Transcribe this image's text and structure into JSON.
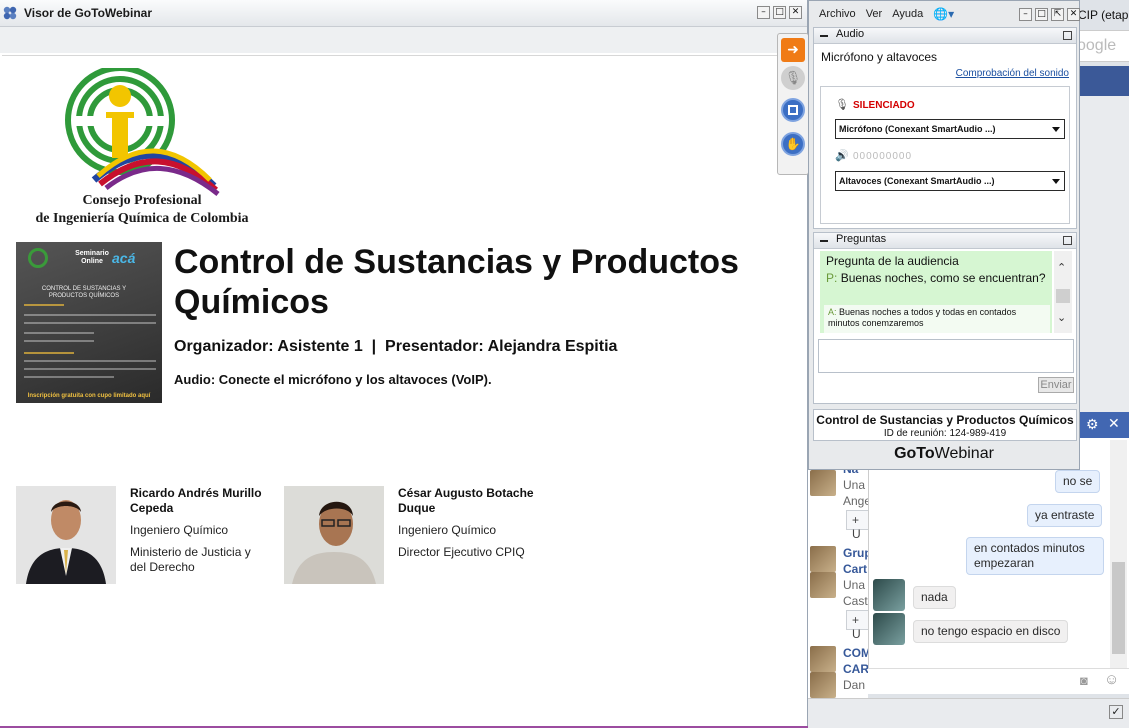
{
  "viewer": {
    "title": "Visor de GoToWebinar",
    "logo_line1": "Consejo Profesional",
    "logo_line2": "de Ingeniería Química de Colombia",
    "webinar_title": "Control de Sustancias y Productos Químicos",
    "organizer_line": "Organizador: Asistente 1  |  Presentador: Alejandra Espitia",
    "audio_line": "Audio: Conecte el micrófono y los altavoces (VoIP).",
    "poster": {
      "seminar": "Seminario Online",
      "aca": "acá",
      "heading": "CONTROL DE SUSTANCIAS Y PRODUCTOS QUÍMICOS",
      "footer": "Inscripción gratuita con cupo limitado aquí"
    },
    "speakers": [
      {
        "name": "Ricardo Andrés Murillo Cepeda",
        "role": "Ingeniero Químico",
        "org": "Ministerio de Justicia y del Derecho"
      },
      {
        "name": "César Augusto Botache Duque",
        "role": "Ingeniero Químico",
        "org": "Director Ejecutivo CPIQ"
      }
    ]
  },
  "panel": {
    "menu": [
      "Archivo",
      "Ver",
      "Ayuda"
    ],
    "audio": {
      "header": "Audio",
      "mode": "Micrófono y altavoces",
      "sound_check": "Comprobación del sonido",
      "status": "SILENCIADO",
      "mic_device": "Micrófono (Conexant SmartAudio ...)",
      "speaker_level": "000000000",
      "speaker_device": "Altavoces (Conexant SmartAudio ...)"
    },
    "questions": {
      "header": "Preguntas",
      "audience_label": "Pregunta de la audiencia",
      "q_prefix": "P:",
      "q_text": "Buenas noches, como se encuentran?",
      "a_prefix": "A:",
      "a_text": "Buenas noches a todos y todas en contados minutos conemzaremos",
      "send": "Enviar"
    },
    "info": {
      "title": "Control de Sustancias y Productos Químicos",
      "meeting_id": "ID de reunión: 124-989-419",
      "brand_go": "GoTo",
      "brand_webinar": "Webinar"
    }
  },
  "background": {
    "window_title": "CIP (etap",
    "search_placeholder": "oogle",
    "list": [
      {
        "name": "Na",
        "sub1": "Una",
        "sub2": "Ange",
        "add": "+ U"
      },
      {
        "name": "Grup",
        "name2": "Cart",
        "sub1": "Una",
        "sub2": "Cast",
        "add": "+ U"
      },
      {
        "name": "COM",
        "name2": "CAR",
        "sub1": "Dan"
      }
    ],
    "chat_messages_out": [
      "no se",
      "ya entraste",
      "en contados minutos empezaran"
    ],
    "chat_messages_in": [
      "nada",
      "no tengo espacio en disco"
    ]
  }
}
